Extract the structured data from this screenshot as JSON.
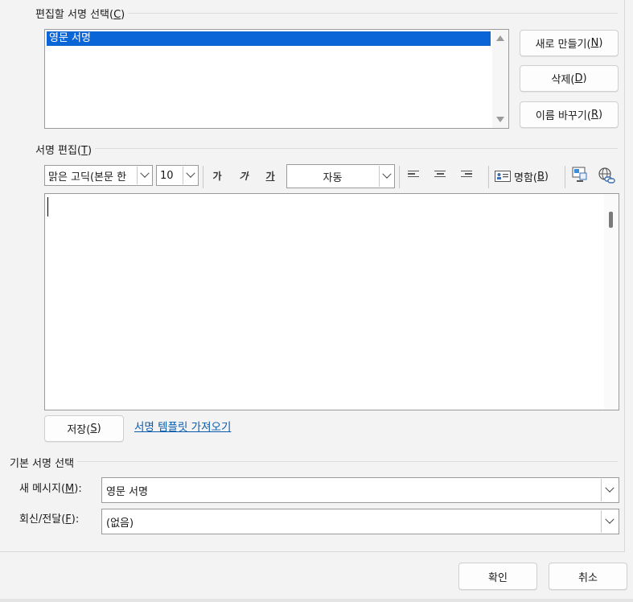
{
  "select_section": {
    "title": "편집할 서명 선택(C)",
    "title_pre": "편집할 서명 선택(",
    "title_key": "C",
    "title_post": ")",
    "signatures": [
      "영문 서명"
    ],
    "selected_index": 0
  },
  "buttons": {
    "new_pre": "새로 만들기(",
    "new_key": "N",
    "new_post": ")",
    "delete_pre": "삭제(",
    "delete_key": "D",
    "delete_post": ")",
    "rename_pre": "이름 바꾸기(",
    "rename_key": "R",
    "rename_post": ")",
    "save_pre": "저장(",
    "save_key": "S",
    "save_post": ")",
    "ok": "확인",
    "cancel": "취소"
  },
  "edit_section": {
    "title_pre": "서명 편집(",
    "title_key": "T",
    "title_post": ")",
    "font_name": "맑은 고딕(본문 한",
    "font_size": "10",
    "bold_label": "가",
    "italic_label": "가",
    "underline_label": "가",
    "color_value": "자동",
    "business_card_pre": "명함(",
    "business_card_key": "B",
    "business_card_post": ")",
    "template_link": "서명 템플릿 가져오기"
  },
  "default_section": {
    "title": "기본 서명 선택",
    "new_message_pre": "새 메시지(",
    "new_message_key": "M",
    "new_message_post": "):",
    "new_message_value": "영문 서명",
    "reply_pre": "회신/전달(",
    "reply_key": "F",
    "reply_post": "):",
    "reply_value": "(없음)"
  },
  "colors": {
    "selection": "#0a66d6",
    "link": "#0b5cad",
    "background": "#f3f3f3"
  }
}
